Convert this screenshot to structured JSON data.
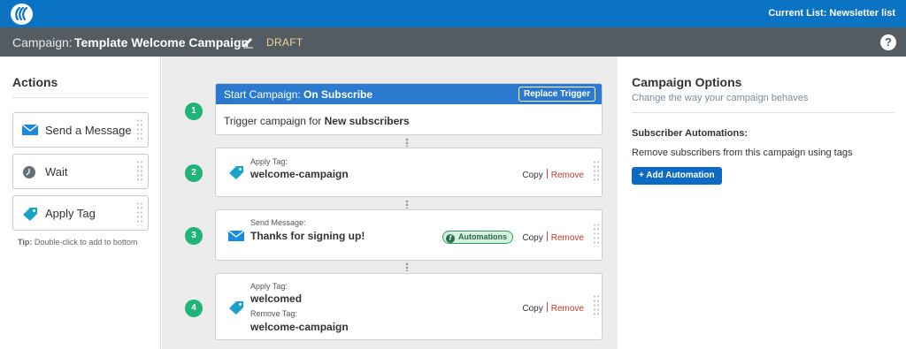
{
  "topbar": {
    "current_list": "Current List: Newsletter list",
    "logo_icon": "brand-logo-icon"
  },
  "campaign_bar": {
    "prefix": "Campaign:",
    "name": "Template Welcome Campaign",
    "status": "DRAFT",
    "edit_icon": "pencil-icon",
    "help_label": "?"
  },
  "actions_panel": {
    "title": "Actions",
    "items": [
      {
        "label": "Send a Message",
        "icon": "envelope-icon"
      },
      {
        "label": "Wait",
        "icon": "clock-icon"
      },
      {
        "label": "Apply Tag",
        "icon": "tag-icon"
      }
    ],
    "tip_bold": "Tip:",
    "tip_text": " Double-click to add to bottom"
  },
  "steps": {
    "s1": {
      "number": "1",
      "head_prefix": "Start Campaign: ",
      "head_bold": "On Subscribe",
      "replace_label": "Replace Trigger",
      "body_prefix": "Trigger campaign for ",
      "body_bold": "New subscribers"
    },
    "s2": {
      "number": "2",
      "label": "Apply Tag:",
      "value": "welcome-campaign",
      "copy": "Copy",
      "remove": "Remove"
    },
    "s3": {
      "number": "3",
      "label": "Send Message:",
      "value": "Thanks for signing up!",
      "automations": "Automations",
      "copy": "Copy",
      "remove": "Remove"
    },
    "s4": {
      "number": "4",
      "label1": "Apply Tag:",
      "value1": "welcomed",
      "label2": "Remove Tag:",
      "value2": "welcome-campaign",
      "copy": "Copy",
      "remove": "Remove"
    }
  },
  "options_panel": {
    "title": "Campaign Options",
    "subtitle": "Change the way your campaign behaves",
    "section_title": "Subscriber Automations:",
    "section_desc": "Remove subscribers from this campaign using tags",
    "add_button": "+ Add Automation"
  },
  "colors": {
    "topbar": "#0a73c4",
    "campaign_bar": "#535b63",
    "draft": "#f1d39a",
    "step_badge": "#21b479",
    "trigger_header": "#2b7ad0",
    "remove_link": "#c0392b"
  }
}
